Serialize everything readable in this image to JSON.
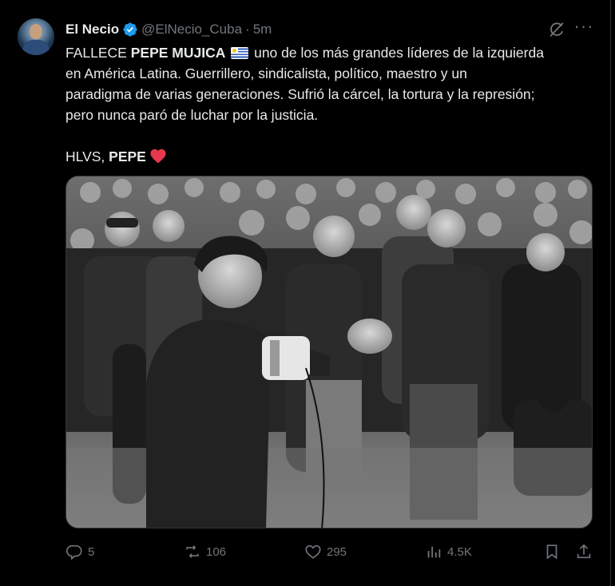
{
  "post": {
    "author": {
      "name": "El Necio",
      "handle": "@ElNecio_Cuba",
      "time": "5m",
      "verified": true
    },
    "text": {
      "line1_prefix": "FALLECE ",
      "line1_bold": "PEPE MUJICA",
      "line1_rest": " uno de los más grandes líderes de la izquierda",
      "line2": "en América Latina. Guerrillero, sindicalista, político, maestro y un",
      "line3": "paradigma de varias generaciones. Sufrió la cárcel, la tortura y la represión;",
      "line4": "pero nunca paró de luchar por la justicia.",
      "closing_prefix": "HLVS, ",
      "closing_bold": "PEPE"
    },
    "stats": {
      "replies": "5",
      "reposts": "106",
      "likes": "295",
      "views": "4.5K"
    }
  },
  "icons": {
    "verified": "verified-badge-icon",
    "grok": "grok-icon",
    "more": "more-icon",
    "flag": "uruguay-flag-icon",
    "heart": "red-heart-icon",
    "reply": "reply-icon",
    "repost": "repost-icon",
    "like": "like-icon",
    "views": "views-icon",
    "bookmark": "bookmark-icon",
    "share": "share-icon"
  },
  "colors": {
    "background": "#000000",
    "text": "#e7e9ea",
    "muted": "#71767b",
    "verified": "#1d9bf0",
    "heart": "#f91880"
  }
}
